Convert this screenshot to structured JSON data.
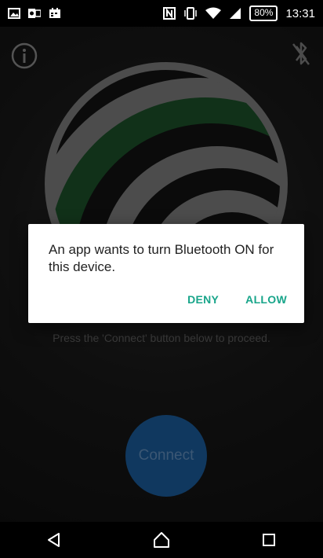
{
  "status_bar": {
    "battery": "80%",
    "time": "13:31",
    "left_icons": [
      "image-icon",
      "outlook-icon",
      "calendar-icon"
    ],
    "right_icons": [
      "nfc-icon",
      "vibrate-icon",
      "wifi-icon",
      "signal-icon"
    ]
  },
  "app": {
    "hint_text": "Press the 'Connect' button below to proceed.",
    "connect_label": "Connect",
    "colors": {
      "connect": "#1e66ad",
      "logo_green": "#1f5a2e",
      "logo_gray": "#8a8a8a"
    },
    "icons": {
      "info": "info-icon",
      "bluetooth": "bluetooth-disabled-icon"
    }
  },
  "dialog": {
    "message": "An app wants to turn Bluetooth ON for this device.",
    "deny_label": "DENY",
    "allow_label": "ALLOW",
    "accent_color": "#18a58a"
  },
  "nav_bar": {
    "icons": [
      "back-icon",
      "home-icon",
      "recents-icon"
    ]
  }
}
